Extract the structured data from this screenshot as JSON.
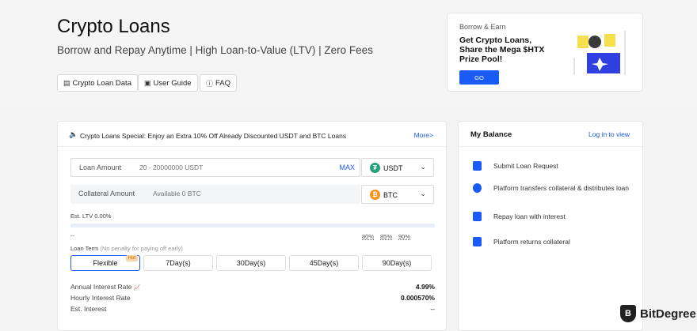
{
  "header": {
    "title": "Crypto Loans",
    "subtitle": "Borrow and Repay Anytime | High Loan-to-Value (LTV) | Zero Fees",
    "links": [
      {
        "label": "Crypto Loan Data",
        "icon": "document-icon"
      },
      {
        "label": "User Guide",
        "icon": "book-icon"
      },
      {
        "label": "FAQ",
        "icon": "question-icon"
      }
    ]
  },
  "promo": {
    "tag": "Borrow & Earn",
    "text": "Get Crypto Loans, Share the Mega $HTX Prize Pool!",
    "button": "GO"
  },
  "loan_form": {
    "notice": "Crypto Loans Special: Enjoy an Extra 10% Off Already Discounted USDT and BTC Loans",
    "more": "More>",
    "loan_label": "Loan Amount",
    "loan_placeholder": "20 - 20000000 USDT",
    "max": "MAX",
    "loan_coin": "USDT",
    "collateral_label": "Collateral Amount",
    "collateral_placeholder": "Available 0 BTC",
    "collateral_coin": "BTC",
    "ltv_label": "Est. LTV 0.00%",
    "ltv_value": 0,
    "ltv_dash": "--",
    "ltv_marks": [
      "80%",
      "85%",
      "90%"
    ],
    "term_label": "Loan Term",
    "term_note": "(No penalty for paying off early)",
    "terms": [
      "Flexible",
      "7Day(s)",
      "30Day(s)",
      "45Day(s)",
      "90Day(s)"
    ],
    "hot": "Hot",
    "annual_rate_label": "Annual Interest Rate",
    "annual_rate": "4.99%",
    "hourly_rate_label": "Hourly Interest Rate",
    "hourly_rate": "0.000570%",
    "est_interest_label": "Est. Interest",
    "est_interest": "--"
  },
  "balance": {
    "title": "My Balance",
    "login": "Log in to view",
    "steps": [
      "Submit Loan Request",
      "Platform transfers collateral & distributes loan",
      "Repay loan with interest",
      "Platform returns collateral"
    ]
  },
  "watermark": {
    "name": "BitDegree"
  },
  "colors": {
    "accent": "#1a5bf5",
    "usdt": "#26a17b",
    "btc": "#f7931a"
  }
}
